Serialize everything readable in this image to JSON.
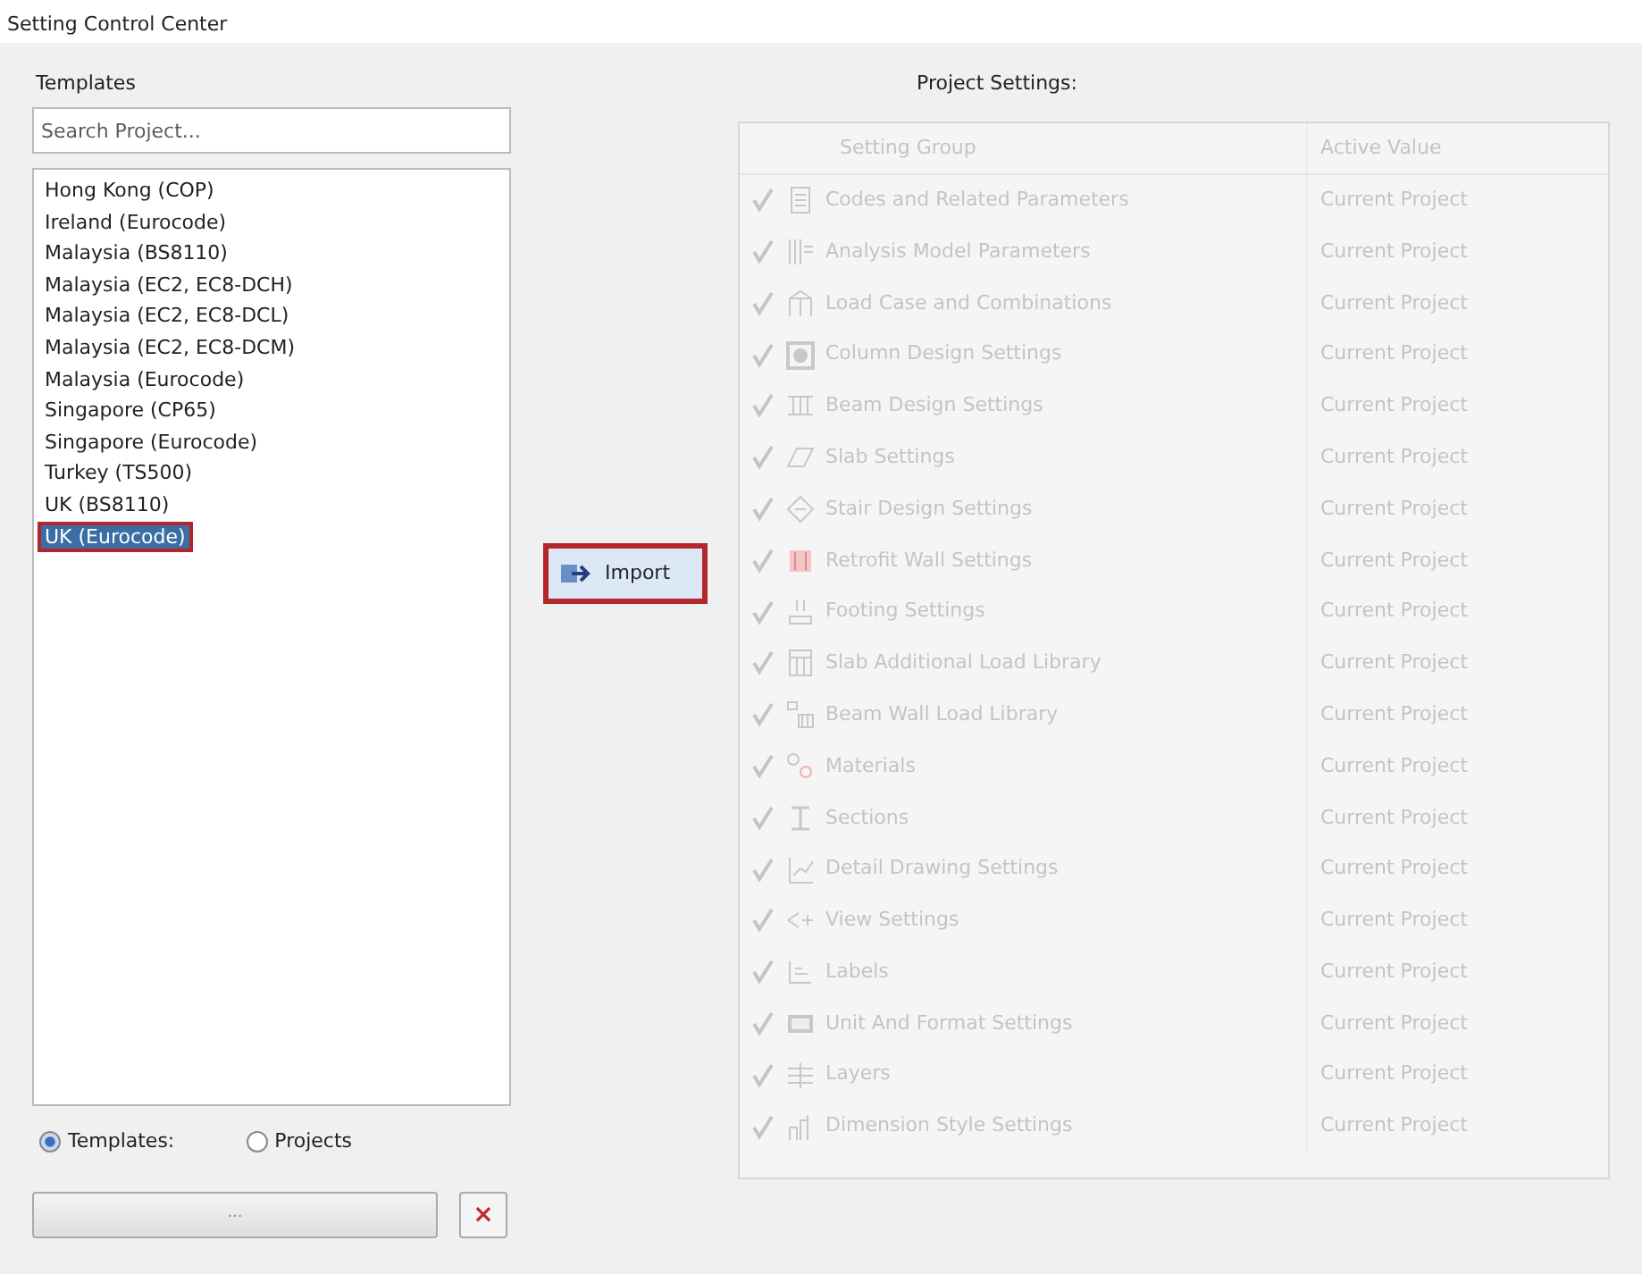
{
  "window": {
    "title": "Setting Control Center"
  },
  "templates": {
    "label": "Templates",
    "search": {
      "placeholder": "Search Project..."
    },
    "items": [
      {
        "label": "Hong Kong (COP)",
        "selected": false,
        "highlighted": false
      },
      {
        "label": "Ireland (Eurocode)",
        "selected": false,
        "highlighted": false
      },
      {
        "label": "Malaysia (BS8110)",
        "selected": false,
        "highlighted": false
      },
      {
        "label": "Malaysia (EC2, EC8-DCH)",
        "selected": false,
        "highlighted": false
      },
      {
        "label": "Malaysia (EC2, EC8-DCL)",
        "selected": false,
        "highlighted": false
      },
      {
        "label": "Malaysia (EC2, EC8-DCM)",
        "selected": false,
        "highlighted": false
      },
      {
        "label": "Malaysia (Eurocode)",
        "selected": false,
        "highlighted": false
      },
      {
        "label": "Singapore (CP65)",
        "selected": false,
        "highlighted": false
      },
      {
        "label": "Singapore (Eurocode)",
        "selected": false,
        "highlighted": false
      },
      {
        "label": "Turkey (TS500)",
        "selected": false,
        "highlighted": false
      },
      {
        "label": "UK (BS8110)",
        "selected": false,
        "highlighted": false
      },
      {
        "label": "UK (Eurocode)",
        "selected": true,
        "highlighted": true
      }
    ],
    "source": [
      {
        "label": "Templates:",
        "selected": true
      },
      {
        "label": "Projects",
        "selected": false
      }
    ],
    "browse_button": "...",
    "clear_button": "×"
  },
  "import_button": {
    "label": "Import",
    "highlighted": true
  },
  "project_settings": {
    "label": "Project Settings:",
    "disabled": true,
    "columns": [
      "Setting Group",
      "Active Value"
    ],
    "rows": [
      {
        "name": "Codes and Related Parameters",
        "value": "Current Project",
        "checked": true
      },
      {
        "name": "Analysis Model Parameters",
        "value": "Current Project",
        "checked": true
      },
      {
        "name": "Load Case and Combinations",
        "value": "Current Project",
        "checked": true
      },
      {
        "name": "Column Design Settings",
        "value": "Current Project",
        "checked": true
      },
      {
        "name": "Beam Design Settings",
        "value": "Current Project",
        "checked": true
      },
      {
        "name": "Slab Settings",
        "value": "Current Project",
        "checked": true
      },
      {
        "name": "Stair Design Settings",
        "value": "Current Project",
        "checked": true
      },
      {
        "name": "Retrofit Wall Settings",
        "value": "Current Project",
        "checked": true
      },
      {
        "name": "Footing Settings",
        "value": "Current Project",
        "checked": true
      },
      {
        "name": "Slab Additional Load Library",
        "value": "Current Project",
        "checked": true
      },
      {
        "name": "Beam Wall Load Library",
        "value": "Current Project",
        "checked": true
      },
      {
        "name": "Materials",
        "value": "Current Project",
        "checked": true
      },
      {
        "name": "Sections",
        "value": "Current Project",
        "checked": true
      },
      {
        "name": "Detail Drawing Settings",
        "value": "Current Project",
        "checked": true
      },
      {
        "name": "View Settings",
        "value": "Current Project",
        "checked": true
      },
      {
        "name": "Labels",
        "value": "Current Project",
        "checked": true
      },
      {
        "name": "Unit And Format Settings",
        "value": "Current Project",
        "checked": true
      },
      {
        "name": "Layers",
        "value": "Current Project",
        "checked": true
      },
      {
        "name": "Dimension Style Settings",
        "value": "Current Project",
        "checked": true
      }
    ]
  }
}
